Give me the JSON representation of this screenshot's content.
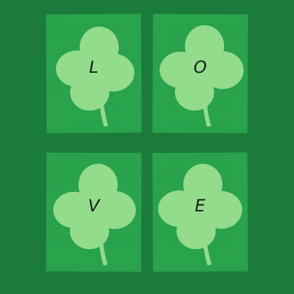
{
  "colors": {
    "background": "#1b7b3a",
    "card": "#27a24b",
    "clover": "#92dc8c",
    "letter": "#1a1a1a"
  },
  "cards": [
    {
      "letter": "L",
      "icon": "shamrock-icon"
    },
    {
      "letter": "O",
      "icon": "shamrock-icon"
    },
    {
      "letter": "V",
      "icon": "shamrock-icon"
    },
    {
      "letter": "E",
      "icon": "shamrock-icon"
    }
  ]
}
